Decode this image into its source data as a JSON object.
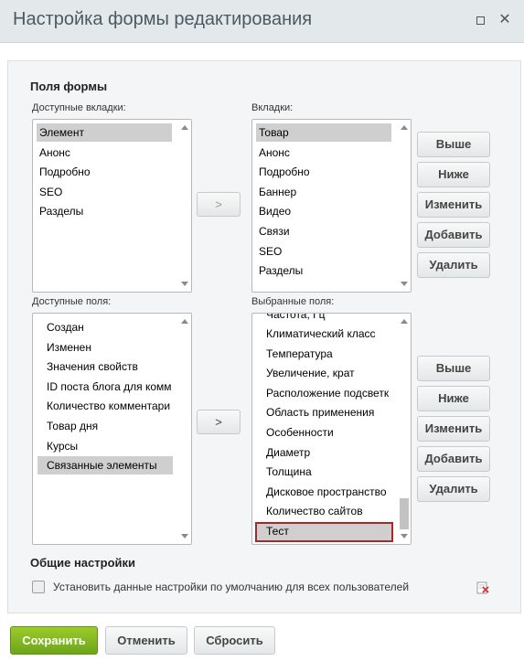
{
  "dialog": {
    "title": "Настройка формы редактирования"
  },
  "form_fields": {
    "heading": "Поля формы",
    "available_tabs_label": "Доступные вкладки:",
    "available_tabs": [
      "Элемент",
      "Анонс",
      "Подробно",
      "SEO",
      "Разделы"
    ],
    "tabs_label": "Вкладки:",
    "tabs": [
      "Товар",
      "Анонс",
      "Подробно",
      "Баннер",
      "Видео",
      "Связи",
      "SEO",
      "Разделы"
    ],
    "move_tab_label": ">",
    "available_fields_label": "Доступные поля:",
    "available_fields": [
      "Создан",
      "Изменен",
      "Значения свойств",
      "ID поста блога для комм",
      "Количество комментари",
      "Товар дня",
      "Курсы",
      "Связанные элементы"
    ],
    "selected_fields_label": "Выбранные поля:",
    "selected_fields": [
      "Частота, Гц",
      "Климатический класс",
      "Температура",
      "Увеличение, крат",
      "Расположение подсветк",
      "Область применения",
      "Особенности",
      "Диаметр",
      "Толщина",
      "Дисковое пространство",
      "Количество сайтов",
      "Тест"
    ],
    "move_field_label": ">",
    "side_buttons": {
      "up": "Выше",
      "down": "Ниже",
      "edit": "Изменить",
      "add": "Добавить",
      "delete": "Удалить"
    }
  },
  "general_settings": {
    "heading": "Общие настройки",
    "default_checkbox_label": "Установить данные настройки по умолчанию для всех пользователей"
  },
  "footer": {
    "save": "Сохранить",
    "cancel": "Отменить",
    "reset": "Сбросить"
  },
  "colors": {
    "save_button": "#7ab51d",
    "highlight_border": "#a32a2a"
  }
}
